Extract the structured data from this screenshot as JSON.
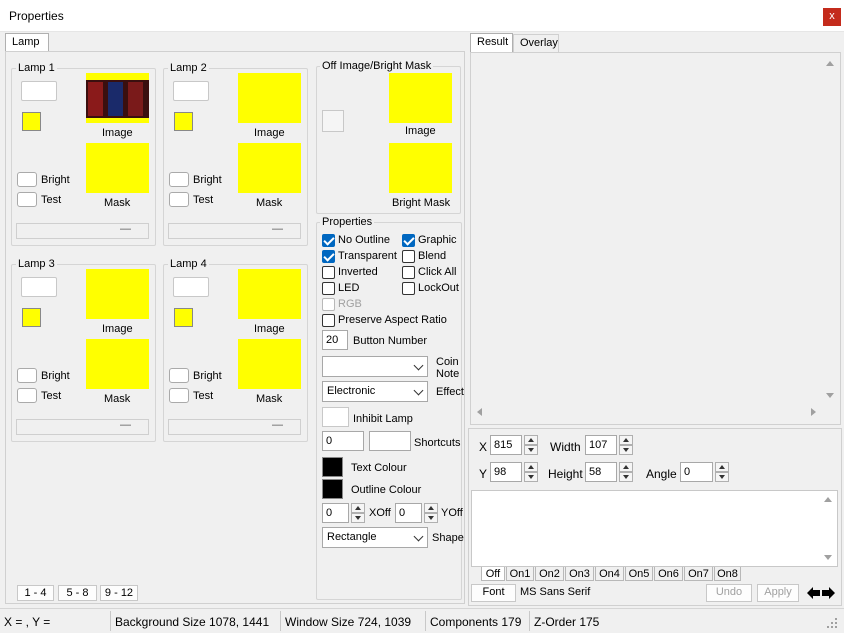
{
  "window": {
    "title": "Properties",
    "close_glyph": "x"
  },
  "left_tab": {
    "label": "Lamp"
  },
  "lamps": [
    {
      "title": "Lamp 1",
      "image_label": "Image",
      "mask_label": "Mask",
      "bright_label": "Bright",
      "test_label": "Test",
      "slider_glyph": "—"
    },
    {
      "title": "Lamp 2",
      "image_label": "Image",
      "mask_label": "Mask",
      "bright_label": "Bright",
      "test_label": "Test",
      "slider_glyph": "—"
    },
    {
      "title": "Lamp 3",
      "image_label": "Image",
      "mask_label": "Mask",
      "bright_label": "Bright",
      "test_label": "Test",
      "slider_glyph": "—"
    },
    {
      "title": "Lamp 4",
      "image_label": "Image",
      "mask_label": "Mask",
      "bright_label": "Bright",
      "test_label": "Test",
      "slider_glyph": "—"
    }
  ],
  "off_image": {
    "title": "Off Image/Bright Mask",
    "image_label": "Image",
    "bright_mask_label": "Bright Mask"
  },
  "page_buttons": [
    "1 - 4",
    "5 - 8",
    "9 - 12"
  ],
  "properties": {
    "title": "Properties",
    "checkboxes": {
      "no_outline": "No Outline",
      "graphic": "Graphic",
      "transparent": "Transparent",
      "blend": "Blend",
      "inverted": "Inverted",
      "click_all": "Click All",
      "led": "LED",
      "lockout": "LockOut",
      "rgb": "RGB",
      "preserve_aspect": "Preserve Aspect Ratio"
    },
    "button_number_value": "20",
    "button_number_label": "Button Number",
    "coin_note_label_1": "Coin",
    "coin_note_label_2": "Note",
    "coin_note_value": "",
    "effect_value": "Electronic",
    "effect_label": "Effect",
    "inhibit_lamp_label": "Inhibit Lamp",
    "shortcut_1": "0",
    "shortcut_2": "",
    "shortcuts_label": "Shortcuts",
    "text_colour_label": "Text Colour",
    "outline_colour_label": "Outline Colour",
    "xoff_value": "0",
    "xoff_label": "XOff",
    "yoff_value": "0",
    "yoff_label": "YOff",
    "shape_value": "Rectangle",
    "shape_label": "Shape",
    "colors": {
      "text": "#000000",
      "outline": "#000000",
      "lamp_swatch": "#ffff00"
    }
  },
  "right_tabs": {
    "result": "Result",
    "overlay": "Overlay"
  },
  "position": {
    "x_label": "X",
    "x_value": "815",
    "width_label": "Width",
    "width_value": "107",
    "y_label": "Y",
    "y_value": "98",
    "height_label": "Height",
    "height_value": "58",
    "angle_label": "Angle",
    "angle_value": "0"
  },
  "state_tabs": [
    "Off",
    "On1",
    "On2",
    "On3",
    "On4",
    "On5",
    "On6",
    "On7",
    "On8"
  ],
  "text_toolbar": {
    "font_button": "Font",
    "font_name": "MS Sans Serif",
    "undo": "Undo",
    "apply": "Apply",
    "left_icon": "arrow-left-icon",
    "right_icon": "arrow-right-icon"
  },
  "status_bar": {
    "coords": "X = , Y =",
    "background_size": "Background Size 1078, 1441",
    "window_size": "Window Size 724, 1039",
    "components": "Components 179",
    "z_order": "Z-Order 175"
  }
}
